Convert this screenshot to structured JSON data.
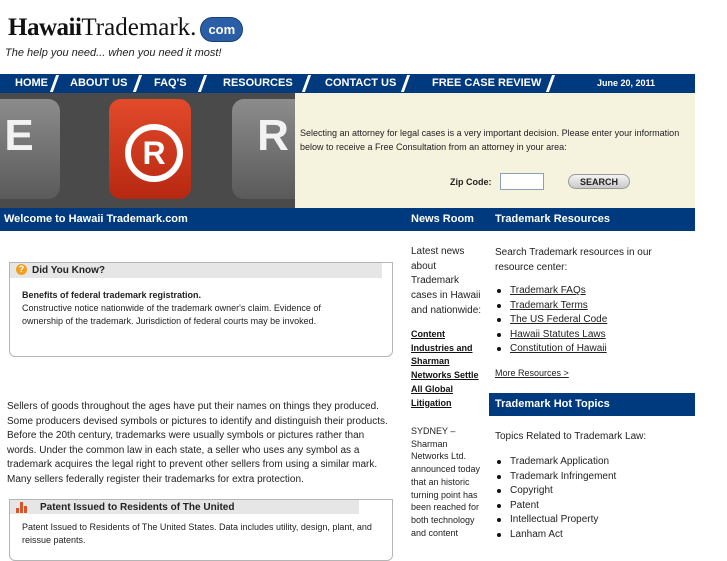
{
  "header": {
    "logo_bold": "Hawaii",
    "logo_rest": "Trademark.",
    "logo_badge": "com",
    "tagline": "The help you need... when you need it most!"
  },
  "nav": {
    "items": [
      "HOME",
      "ABOUT US",
      "FAQ'S",
      "RESOURCES",
      "CONTACT US",
      "FREE CASE REVIEW"
    ],
    "date": "June 20, 2011"
  },
  "hero": {
    "keys": [
      "E",
      "R",
      "R"
    ],
    "cta_text": "Selecting an attorney for legal cases is a very important decision. Please enter your information below to receive a Free Consultation from an attorney in your area:",
    "zip_label": "Zip Code:",
    "zip_value": "",
    "search_label": "SEARCH"
  },
  "sections": {
    "welcome": "Welcome to Hawaii Trademark.com",
    "news": "News Room",
    "resources": "Trademark Resources",
    "hot_topics": "Trademark Hot Topics"
  },
  "did_you_know": {
    "tab": "Did You Know?",
    "title": "Benefits of federal trademark registration.",
    "body": "Constructive notice nationwide of the trademark owner's claim. Evidence of ownership of the trademark. Jurisdiction of federal courts may be invoked."
  },
  "main_paragraph": "Sellers of goods throughout the ages have put their names on things they produced. Some producers devised symbols or pictures to identify and distinguish their products. Before the 20th century, trademarks were usually symbols or pictures rather than words. Under the common law in each state, a seller who uses any symbol as a trademark acquires the legal right to prevent other sellers from using a similar mark. Many sellers federally register their trademarks for extra protection.",
  "patent_box": {
    "tab": "Patent Issued to Residents of The United",
    "body": "Patent Issued to Residents of The United States. Data includes utility, design, plant, and reissue patents."
  },
  "news": {
    "intro": "Latest news about Trademark cases in Hawaii and nationwide:",
    "headline": "Content Industries and Sharman Networks Settle All Global Litigation",
    "body": "SYDNEY – Sharman Networks Ltd. announced today that an historic turning point has been reached for both technology and content"
  },
  "resources": {
    "intro": "Search Trademark resources in our resource center:",
    "links": [
      "Trademark FAQs",
      "Trademark Terms",
      "The US Federal Code",
      "Hawaii Statutes Laws",
      "Constitution of Hawaii"
    ],
    "more": "More Resources >"
  },
  "hot_topics": {
    "intro": "Topics Related to Trademark Law:",
    "items": [
      "Trademark Application",
      "Trademark Infringement",
      "Copyright",
      "Patent",
      "Intellectual Property",
      "Lanham Act"
    ]
  },
  "colors": {
    "brand_blue": "#003a7e",
    "cta_background": "#f5f2dd",
    "key_red": "#c9341a"
  }
}
